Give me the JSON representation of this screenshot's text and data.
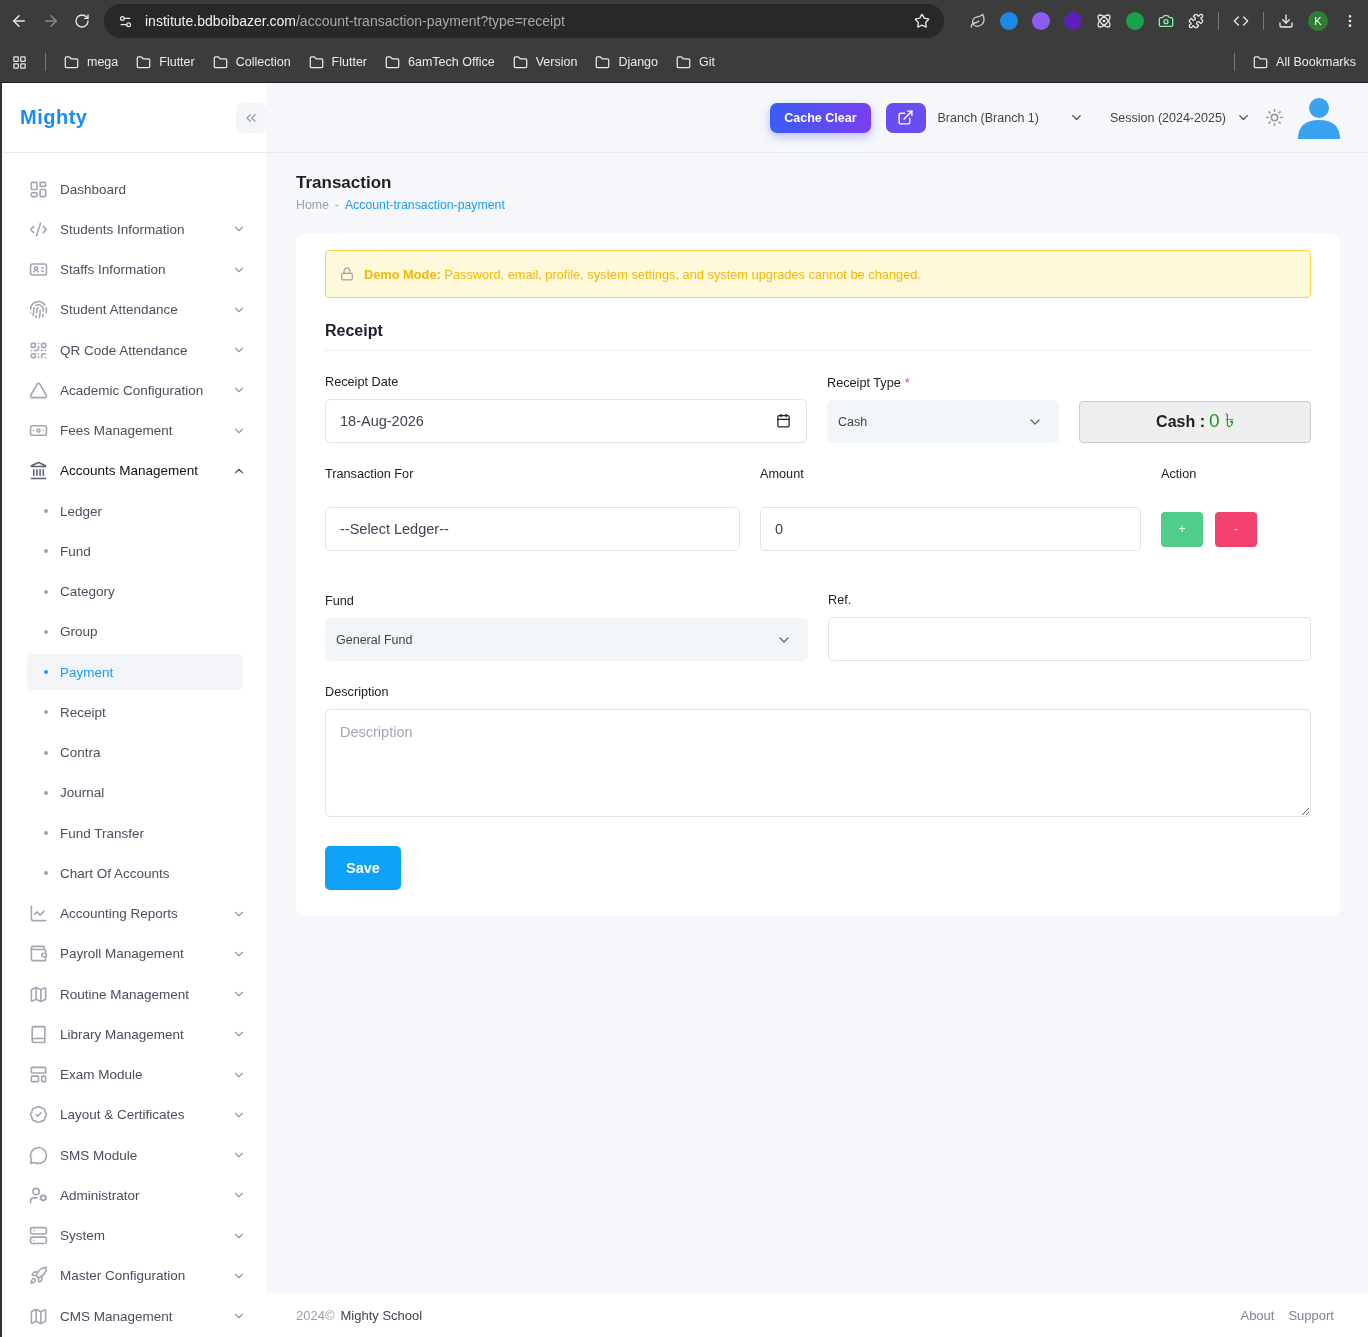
{
  "browser": {
    "url_host": "institute.bdboibazer.com",
    "url_path": "/account-transaction-payment?type=receipt",
    "profile_initial": "K",
    "bookmarks": [
      "mega",
      "Flutter",
      "Collection",
      "Flutter",
      "6amTech Office",
      "Version",
      "Django",
      "Git"
    ],
    "all_bookmarks": "All Bookmarks"
  },
  "sidebar": {
    "logo": "Mighty",
    "items": [
      {
        "kind": "link",
        "label": "Dashboard"
      },
      {
        "kind": "group",
        "label": "Students Information",
        "expanded": false
      },
      {
        "kind": "group",
        "label": "Staffs Information",
        "expanded": false
      },
      {
        "kind": "group",
        "label": "Student Attendance",
        "expanded": false
      },
      {
        "kind": "group",
        "label": "QR Code Attendance",
        "expanded": false
      },
      {
        "kind": "group",
        "label": "Academic Configuration",
        "expanded": false
      },
      {
        "kind": "group",
        "label": "Fees Management",
        "expanded": false
      },
      {
        "kind": "group",
        "label": "Accounts Management",
        "expanded": true,
        "children": [
          {
            "label": "Ledger",
            "selected": false
          },
          {
            "label": "Fund",
            "selected": false
          },
          {
            "label": "Category",
            "selected": false
          },
          {
            "label": "Group",
            "selected": false
          },
          {
            "label": "Payment",
            "selected": true
          },
          {
            "label": "Receipt",
            "selected": false
          },
          {
            "label": "Contra",
            "selected": false
          },
          {
            "label": "Journal",
            "selected": false
          },
          {
            "label": "Fund Transfer",
            "selected": false
          },
          {
            "label": "Chart Of Accounts",
            "selected": false
          }
        ]
      },
      {
        "kind": "group",
        "label": "Accounting Reports",
        "expanded": false
      },
      {
        "kind": "group",
        "label": "Payroll Management",
        "expanded": false
      },
      {
        "kind": "group",
        "label": "Routine Management",
        "expanded": false
      },
      {
        "kind": "group",
        "label": "Library Management",
        "expanded": false
      },
      {
        "kind": "group",
        "label": "Exam Module",
        "expanded": false
      },
      {
        "kind": "group",
        "label": "Layout & Certificates",
        "expanded": false
      },
      {
        "kind": "group",
        "label": "SMS Module",
        "expanded": false
      },
      {
        "kind": "group",
        "label": "Administrator",
        "expanded": false
      },
      {
        "kind": "group",
        "label": "System",
        "expanded": false
      },
      {
        "kind": "group",
        "label": "Master Configuration",
        "expanded": false
      },
      {
        "kind": "group",
        "label": "CMS Management",
        "expanded": false
      }
    ]
  },
  "header": {
    "cache_clear": "Cache Clear",
    "branch": "Branch (Branch 1)",
    "session": "Session (2024-2025)"
  },
  "page": {
    "title": "Transaction",
    "breadcrumb_separator": "-",
    "breadcrumb": [
      {
        "label": "Home",
        "current": false
      },
      {
        "label": "Account-transaction-payment",
        "current": true
      }
    ]
  },
  "alert": {
    "text": "**Demo Mode:** Password, email, profile, system settings, and system upgrades cannot be changed."
  },
  "form": {
    "section_title": "Receipt",
    "receipt_date": {
      "label": "Receipt Date",
      "value": "18-Aug-2026"
    },
    "receipt_type": {
      "label": "Receipt Type",
      "required_mark": "*",
      "value": "Cash"
    },
    "cash": {
      "label": "Cash :",
      "value": "0 ৳"
    },
    "transaction_for": {
      "label": "Transaction For",
      "value": "--Select Ledger--"
    },
    "amount": {
      "label": "Amount",
      "value": "0"
    },
    "action": {
      "label": "Action",
      "add": "+",
      "remove": "-"
    },
    "fund": {
      "label": "Fund",
      "value": "General Fund"
    },
    "ref": {
      "label": "Ref."
    },
    "description": {
      "label": "Description",
      "placeholder": "Description"
    },
    "save": "Save"
  },
  "footer": {
    "year": "2024©",
    "brand": "Mighty School",
    "links": [
      "About",
      "Support"
    ]
  }
}
